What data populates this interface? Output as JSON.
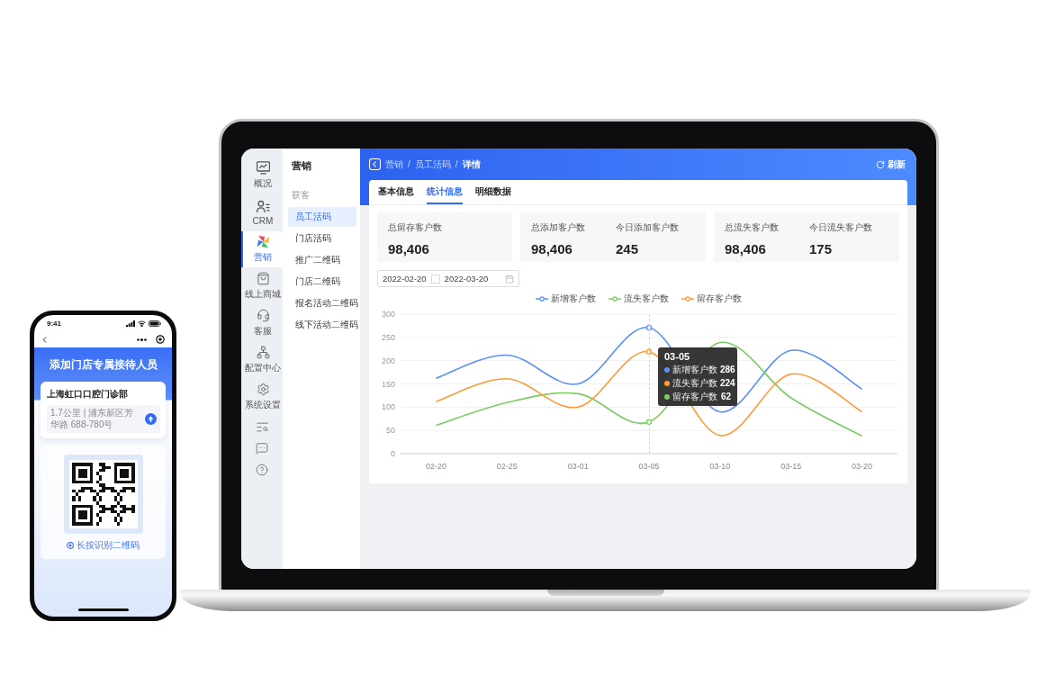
{
  "phone": {
    "status_time": "9:41",
    "title": "添加门店专属接待人员",
    "store": {
      "name": "上海虹口口腔门诊部",
      "address": "1.7公里 | 浦东新区芳华路 688-780号"
    },
    "qr_hint": "长按识别二维码"
  },
  "laptop": {
    "rail": [
      {
        "label": "概况",
        "selected": false
      },
      {
        "label": "CRM",
        "selected": false
      },
      {
        "label": "营销",
        "selected": true
      },
      {
        "label": "线上商城",
        "selected": false
      },
      {
        "label": "客服",
        "selected": false
      },
      {
        "label": "配置中心",
        "selected": false
      },
      {
        "label": "系统设置",
        "selected": false
      }
    ],
    "menu": {
      "title": "营销",
      "group": "获客",
      "items": [
        {
          "label": "员工活码",
          "selected": true
        },
        {
          "label": "门店活码",
          "selected": false
        },
        {
          "label": "推广二维码",
          "selected": false
        },
        {
          "label": "门店二维码",
          "selected": false
        },
        {
          "label": "报名活动二维码",
          "selected": false
        },
        {
          "label": "线下活动二维码",
          "selected": false
        }
      ]
    },
    "breadcrumb": {
      "items": [
        {
          "label": "营销",
          "current": false
        },
        {
          "label": "员工活码",
          "current": false
        },
        {
          "label": "详情",
          "current": true
        }
      ],
      "separators": [
        "/",
        "/"
      ]
    },
    "refresh": "刷新",
    "tabs": [
      {
        "label": "基本信息",
        "selected": false
      },
      {
        "label": "统计信息",
        "selected": true
      },
      {
        "label": "明细数据",
        "selected": false
      }
    ],
    "stat_cards": [
      {
        "stats": [
          {
            "label": "总留存客户数",
            "value": "98,406"
          }
        ]
      },
      {
        "stats": [
          {
            "label": "总添加客户数",
            "value": "98,406"
          },
          {
            "label": "今日添加客户数",
            "value": "245"
          }
        ]
      },
      {
        "stats": [
          {
            "label": "总流失客户数",
            "value": "98,406"
          },
          {
            "label": "今日流失客户数",
            "value": "175"
          }
        ]
      }
    ],
    "date_range": {
      "start": "2022-02-20",
      "end": "2022-03-20"
    },
    "chart": {
      "chart_data": {
        "type": "line",
        "categories": [
          "02-20",
          "02-25",
          "03-01",
          "03-05",
          "03-10",
          "03-15",
          "03-20"
        ],
        "series": [
          {
            "name": "新增客户数",
            "color": "#5b8ff9",
            "values": [
              162,
              212,
              150,
              271,
              90,
              222,
              139
            ]
          },
          {
            "name": "流失客户数",
            "color": "#7ccb62",
            "values": [
              61,
              110,
              129,
              68,
              239,
              120,
              38
            ]
          },
          {
            "name": "留存客户数",
            "color": "#ff9b37",
            "values": [
              112,
              161,
              100,
              219,
              39,
              171,
              90
            ]
          }
        ],
        "ylim": [
          0,
          300
        ],
        "yticks": [
          0,
          50,
          100,
          150,
          200,
          250,
          300
        ],
        "grid": true,
        "legend": true
      },
      "tooltip": {
        "title": "03-05",
        "rows": [
          {
            "label": "新增客户数",
            "value": "286",
            "color": "#5b8ff9"
          },
          {
            "label": "流失客户数",
            "value": "224",
            "color": "#ff9b37"
          },
          {
            "label": "留存客户数",
            "value": "62",
            "color": "#7ccb62"
          }
        ]
      }
    }
  }
}
